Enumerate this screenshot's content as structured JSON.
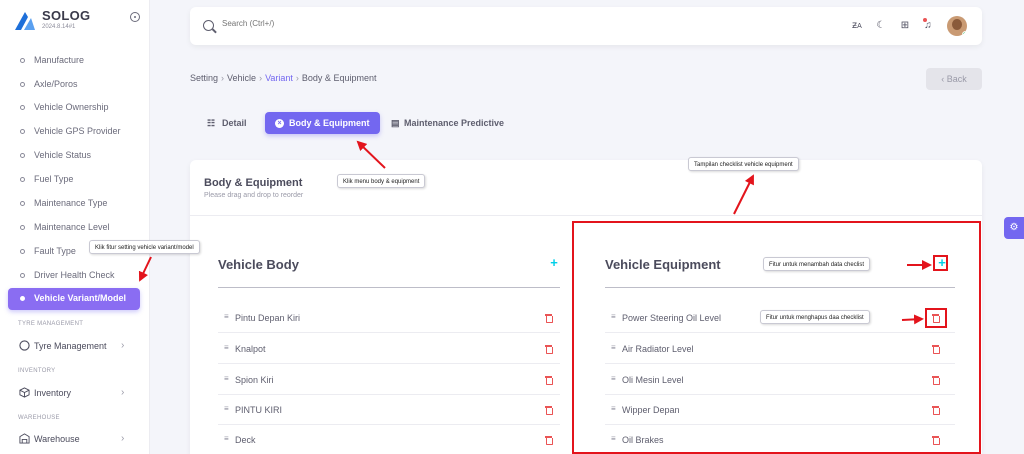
{
  "brand": {
    "name": "SOLOG",
    "version": "2024.8.14#1"
  },
  "sidebar": {
    "items": [
      {
        "label": "Manufacture"
      },
      {
        "label": "Axle/Poros"
      },
      {
        "label": "Vehicle Ownership"
      },
      {
        "label": "Vehicle GPS Provider"
      },
      {
        "label": "Vehicle Status"
      },
      {
        "label": "Fuel Type"
      },
      {
        "label": "Maintenance Type"
      },
      {
        "label": "Maintenance Level"
      },
      {
        "label": "Fault Type"
      },
      {
        "label": "Driver Health Check"
      },
      {
        "label": "Vehicle Variant/Model"
      }
    ],
    "sections": [
      {
        "title": "TYRE MANAGEMENT",
        "item": "Tyre Management"
      },
      {
        "title": "INVENTORY",
        "item": "Inventory"
      },
      {
        "title": "WAREHOUSE",
        "item": "Warehouse"
      }
    ]
  },
  "search": {
    "placeholder": "Search (Ctrl+/)"
  },
  "breadcrumb": {
    "items": [
      "Setting",
      "Vehicle",
      "Variant",
      "Body & Equipment"
    ]
  },
  "back_label": "Back",
  "tabs": [
    {
      "label": "Detail"
    },
    {
      "label": "Body & Equipment"
    },
    {
      "label": "Maintenance Predictive"
    }
  ],
  "card": {
    "title": "Body & Equipment",
    "subtitle": "Please drag and drop to reorder"
  },
  "vehicle_body": {
    "title": "Vehicle Body",
    "items": [
      "Pintu Depan Kiri",
      "Knalpot",
      "Spion Kiri",
      "PINTU KIRI",
      "Deck"
    ]
  },
  "vehicle_equipment": {
    "title": "Vehicle Equipment",
    "items": [
      "Power Steering Oil Level",
      "Air Radiator Level",
      "Oli Mesin Level",
      "Wipper Depan",
      "Oil Brakes"
    ]
  },
  "annotations": {
    "sidebar_note": "Klik fitur setting vehicle variant/model",
    "menu_note": "Klik menu body & equipment",
    "checklist_note": "Tampilan checklist vehicle equipment",
    "add_note": "Fitur untuk menambah data checlist",
    "delete_note": "Fitur untuk menghapus daa checklist"
  },
  "colors": {
    "primary": "#7367f0",
    "danger": "#ea5455",
    "info": "#00cfe8",
    "annotation": "#e3141c"
  }
}
